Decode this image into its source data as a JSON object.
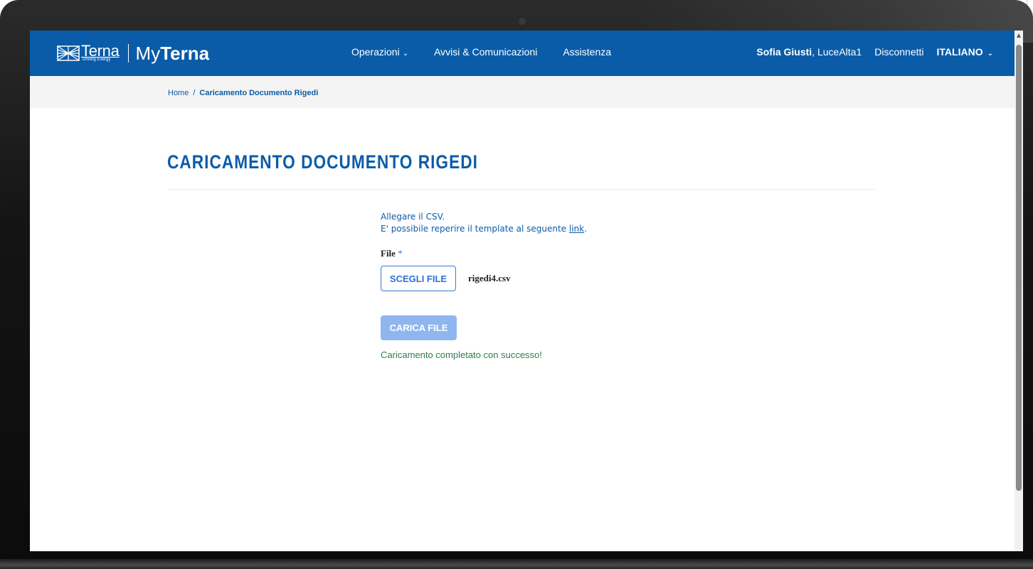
{
  "header": {
    "brand": {
      "terna": "Terna",
      "tagline": "Driving Energy",
      "my": "My",
      "myterna": "Terna"
    },
    "nav": [
      {
        "label": "Operazioni",
        "has_dropdown": true
      },
      {
        "label": "Avvisi & Comunicazioni",
        "has_dropdown": false
      },
      {
        "label": "Assistenza",
        "has_dropdown": false
      }
    ],
    "user": {
      "name": "Sofia Giusti",
      "account": ", LuceAlta1",
      "logout": "Disconnetti",
      "language": "ITALIANO"
    }
  },
  "breadcrumb": {
    "home": "Home",
    "separator": "/",
    "current": "Caricamento Documento Rigedi"
  },
  "page": {
    "title": "CARICAMENTO DOCUMENTO RIGEDI"
  },
  "form": {
    "intro_line1": "Allegare il CSV.",
    "intro_line2_prefix": "E' possibile reperire il template al seguente ",
    "intro_link": "link",
    "intro_line2_suffix": ".",
    "file_label": "File",
    "required_mark": "*",
    "choose_button": "SCEGLI FILE",
    "file_name": "rigedi4.csv",
    "upload_button": "CARICA FILE",
    "success_message": "Caricamento completato con successo!"
  },
  "colors": {
    "brand_blue": "#0a5ca8",
    "button_blue": "#2d6fd6",
    "disabled_button": "#90b6f0",
    "success_green": "#2e7d4f"
  },
  "icons": {
    "nav_dropdown": "chevron-down-icon",
    "language_dropdown": "chevron-down-icon",
    "brand_mark": "terna-logo-icon"
  }
}
